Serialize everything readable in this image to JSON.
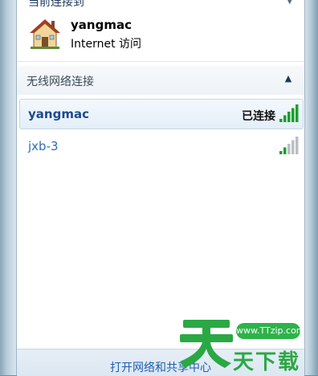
{
  "current_connection": {
    "header": "当前连接到",
    "ssid": "yangmac",
    "access_type": "Internet 访问"
  },
  "wireless_section": {
    "label": "无线网络连接",
    "collapse_glyph": "▲"
  },
  "networks": [
    {
      "name": "yangmac",
      "status": "已连接",
      "signal_bars": 5,
      "color": "#1b9e2e"
    },
    {
      "name": "jxb-3",
      "status": "",
      "signal_bars": 2,
      "color": "#1b9e2e"
    }
  ],
  "footer": {
    "link": "打开网络和共享中心"
  },
  "watermark": {
    "url": "www.TTzip.com",
    "text": "天下载",
    "color": "#2aa844"
  }
}
